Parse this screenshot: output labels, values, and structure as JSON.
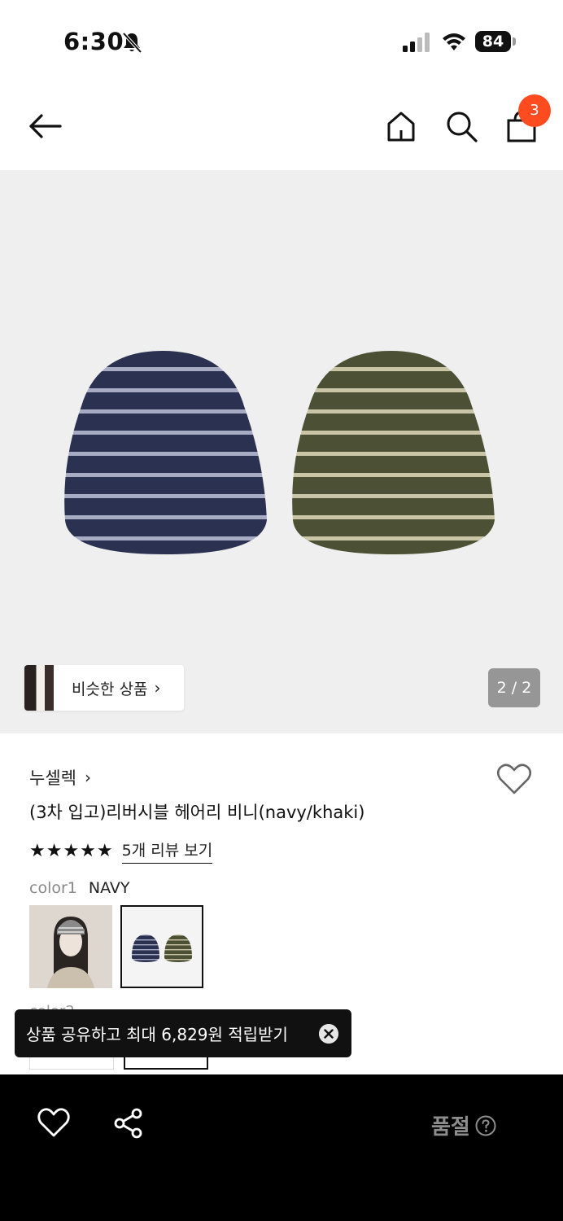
{
  "status_bar": {
    "time": "6:30",
    "battery": "84"
  },
  "nav": {
    "cart_count": "3"
  },
  "gallery": {
    "similar_label": "비슷한 상품",
    "page_indicator": "2 / 2"
  },
  "product": {
    "brand": "누셀렉",
    "title": "(3차 입고)리버시블 헤어리 비니(navy/khaki)",
    "stars": "★★★★★",
    "review_link": "5개 리뷰 보기",
    "color1_key": "color1",
    "color1_value": "NAVY",
    "color2_key": "color2"
  },
  "toast": {
    "text": "상품 공유하고 최대 6,829원 적립받기"
  },
  "bottom_bar": {
    "soldout_label": "품절"
  },
  "colors": {
    "badge": "#ff4b1f",
    "navy": "#2b3150",
    "khaki": "#4c5034"
  }
}
